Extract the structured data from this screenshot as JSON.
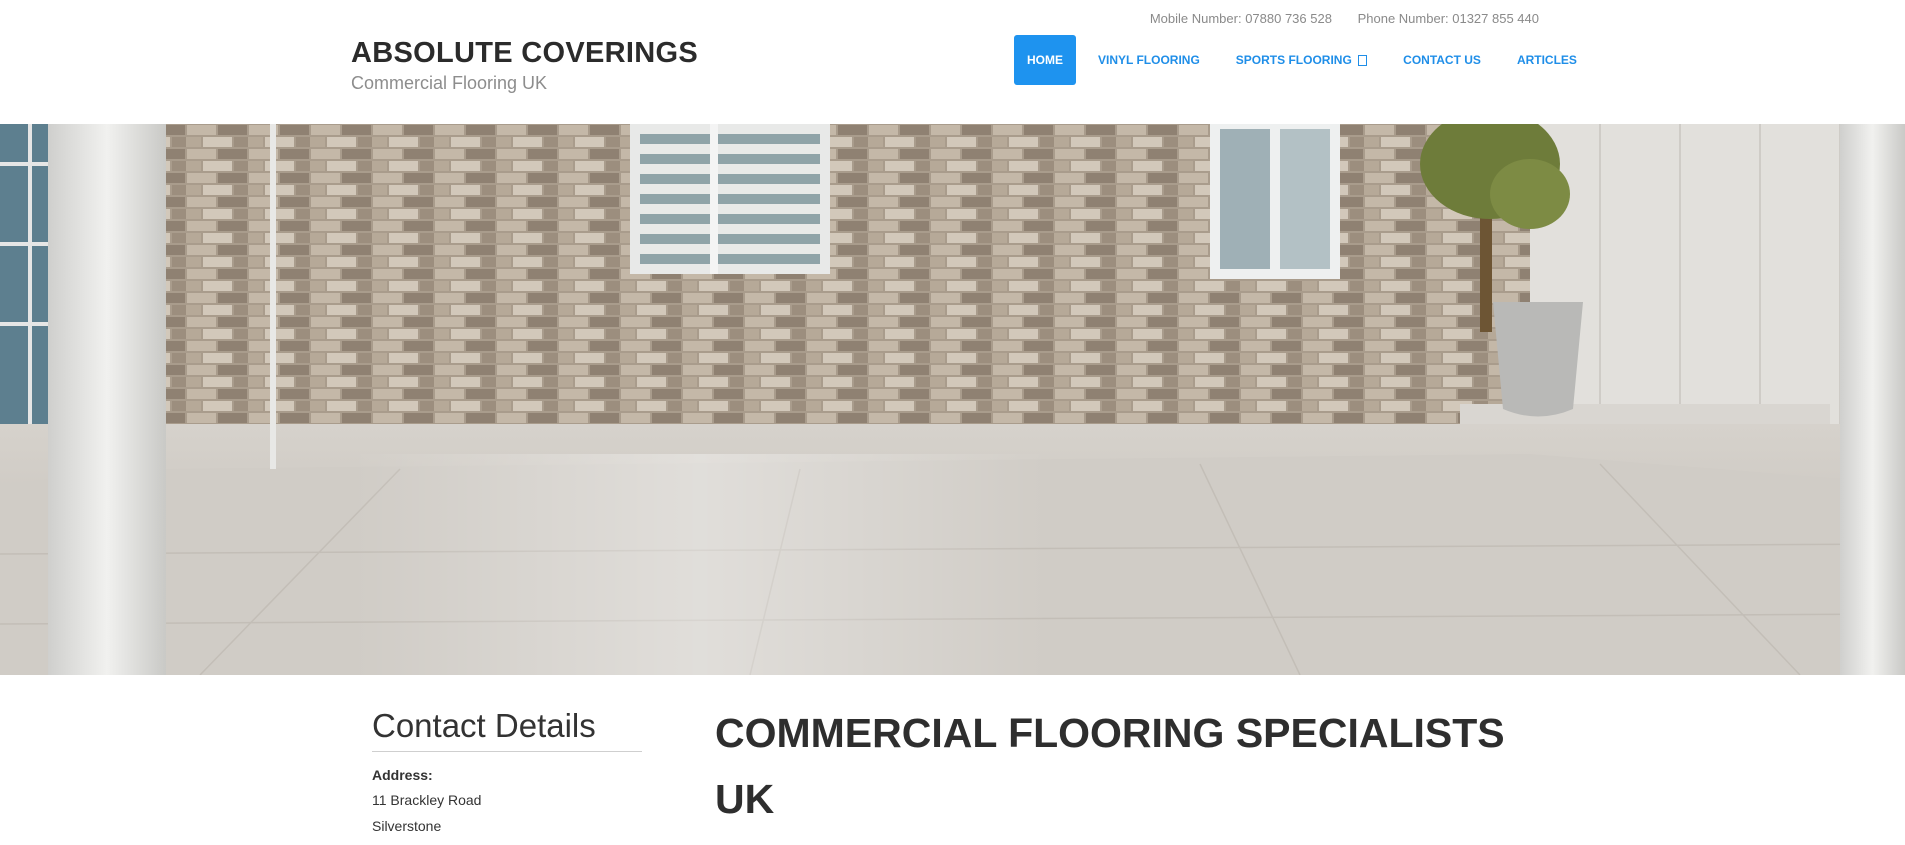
{
  "header": {
    "mobile_label": "Mobile Number: 07880 736 528",
    "phone_label": "Phone Number: 01327 855 440",
    "brand_title": "ABSOLUTE COVERINGS",
    "brand_subtitle": "Commercial Flooring UK"
  },
  "nav": {
    "items": [
      {
        "label": "HOME",
        "active": true
      },
      {
        "label": "VINYL FLOORING"
      },
      {
        "label": "SPORTS FLOORING"
      },
      {
        "label": "CONTACT US"
      },
      {
        "label": "ARTICLES"
      }
    ],
    "dropdown_icon": "chevron-down-icon"
  },
  "colors": {
    "accent": "#1e93ef",
    "nav_text": "#1f8ee8",
    "heading": "#2e2e2e"
  },
  "sidebar": {
    "title": "Contact Details",
    "address_label": "Address:",
    "address_lines": [
      "11 Brackley Road",
      "Silverstone"
    ]
  },
  "main": {
    "heading": "COMMERCIAL FLOORING SPECIALISTS UK"
  }
}
